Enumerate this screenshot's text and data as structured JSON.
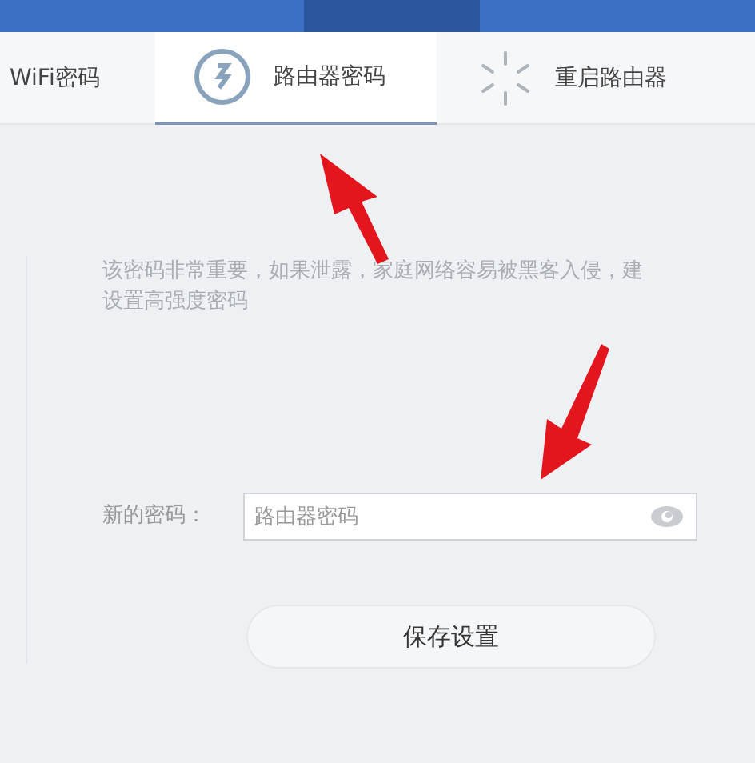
{
  "tabs": [
    {
      "label": "WiFi密码",
      "kind": "plain",
      "selected": false
    },
    {
      "label": "路由器密码",
      "kind": "key",
      "selected": true
    },
    {
      "label": "重启路由器",
      "kind": "spinner",
      "selected": false
    }
  ],
  "description": [
    "该密码非常重要，如果泄露，家庭网络容易被黑客入侵，建",
    "设置高强度密码"
  ],
  "password": {
    "label": "新的密码：",
    "placeholder": "路由器密码"
  },
  "save_button": "保存设置"
}
